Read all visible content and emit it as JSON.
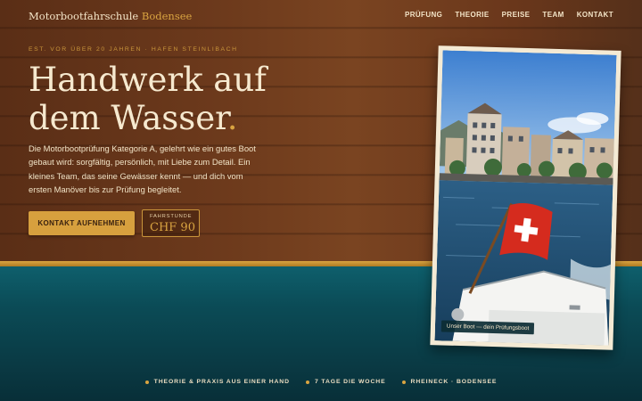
{
  "nav": {
    "brand_main": "Motorbootfahrschule",
    "brand_accent": "Bodensee",
    "links": [
      "PRÜFUNG",
      "THEORIE",
      "PREISE",
      "TEAM",
      "KONTAKT"
    ]
  },
  "hero": {
    "eyebrow": "EST. VOR ÜBER 20 JAHREN · HAFEN STEINLIBACH",
    "headline_line1": "Handwerk auf",
    "headline_line2": "dem Wasser",
    "headline_dot": ".",
    "lead": "Die Motorbootprüfung Kategorie A, gelehrt wie ein gutes Boot gebaut wird: sorgfältig, persönlich, mit Liebe zum Detail. Ein kleines Team, das seine Gewässer kennt — und dich vom ersten Manöver bis zur Prüfung begleitet.",
    "cta_label": "KONTAKT AUFNEHMEN",
    "price_label": "FAHRSTUNDE",
    "price_value": "CHF 90"
  },
  "photo": {
    "caption": "Unser Boot — dein Prüfungsboot"
  },
  "features": [
    "THEORIE & PRAXIS AUS EINER HAND",
    "7 TAGE DIE WOCHE",
    "RHEINECK · BODENSEE"
  ],
  "colors": {
    "accent": "#d9a441",
    "wood": "#6d3a1c",
    "water": "#0b4b56",
    "cream": "#f6e9cf"
  }
}
